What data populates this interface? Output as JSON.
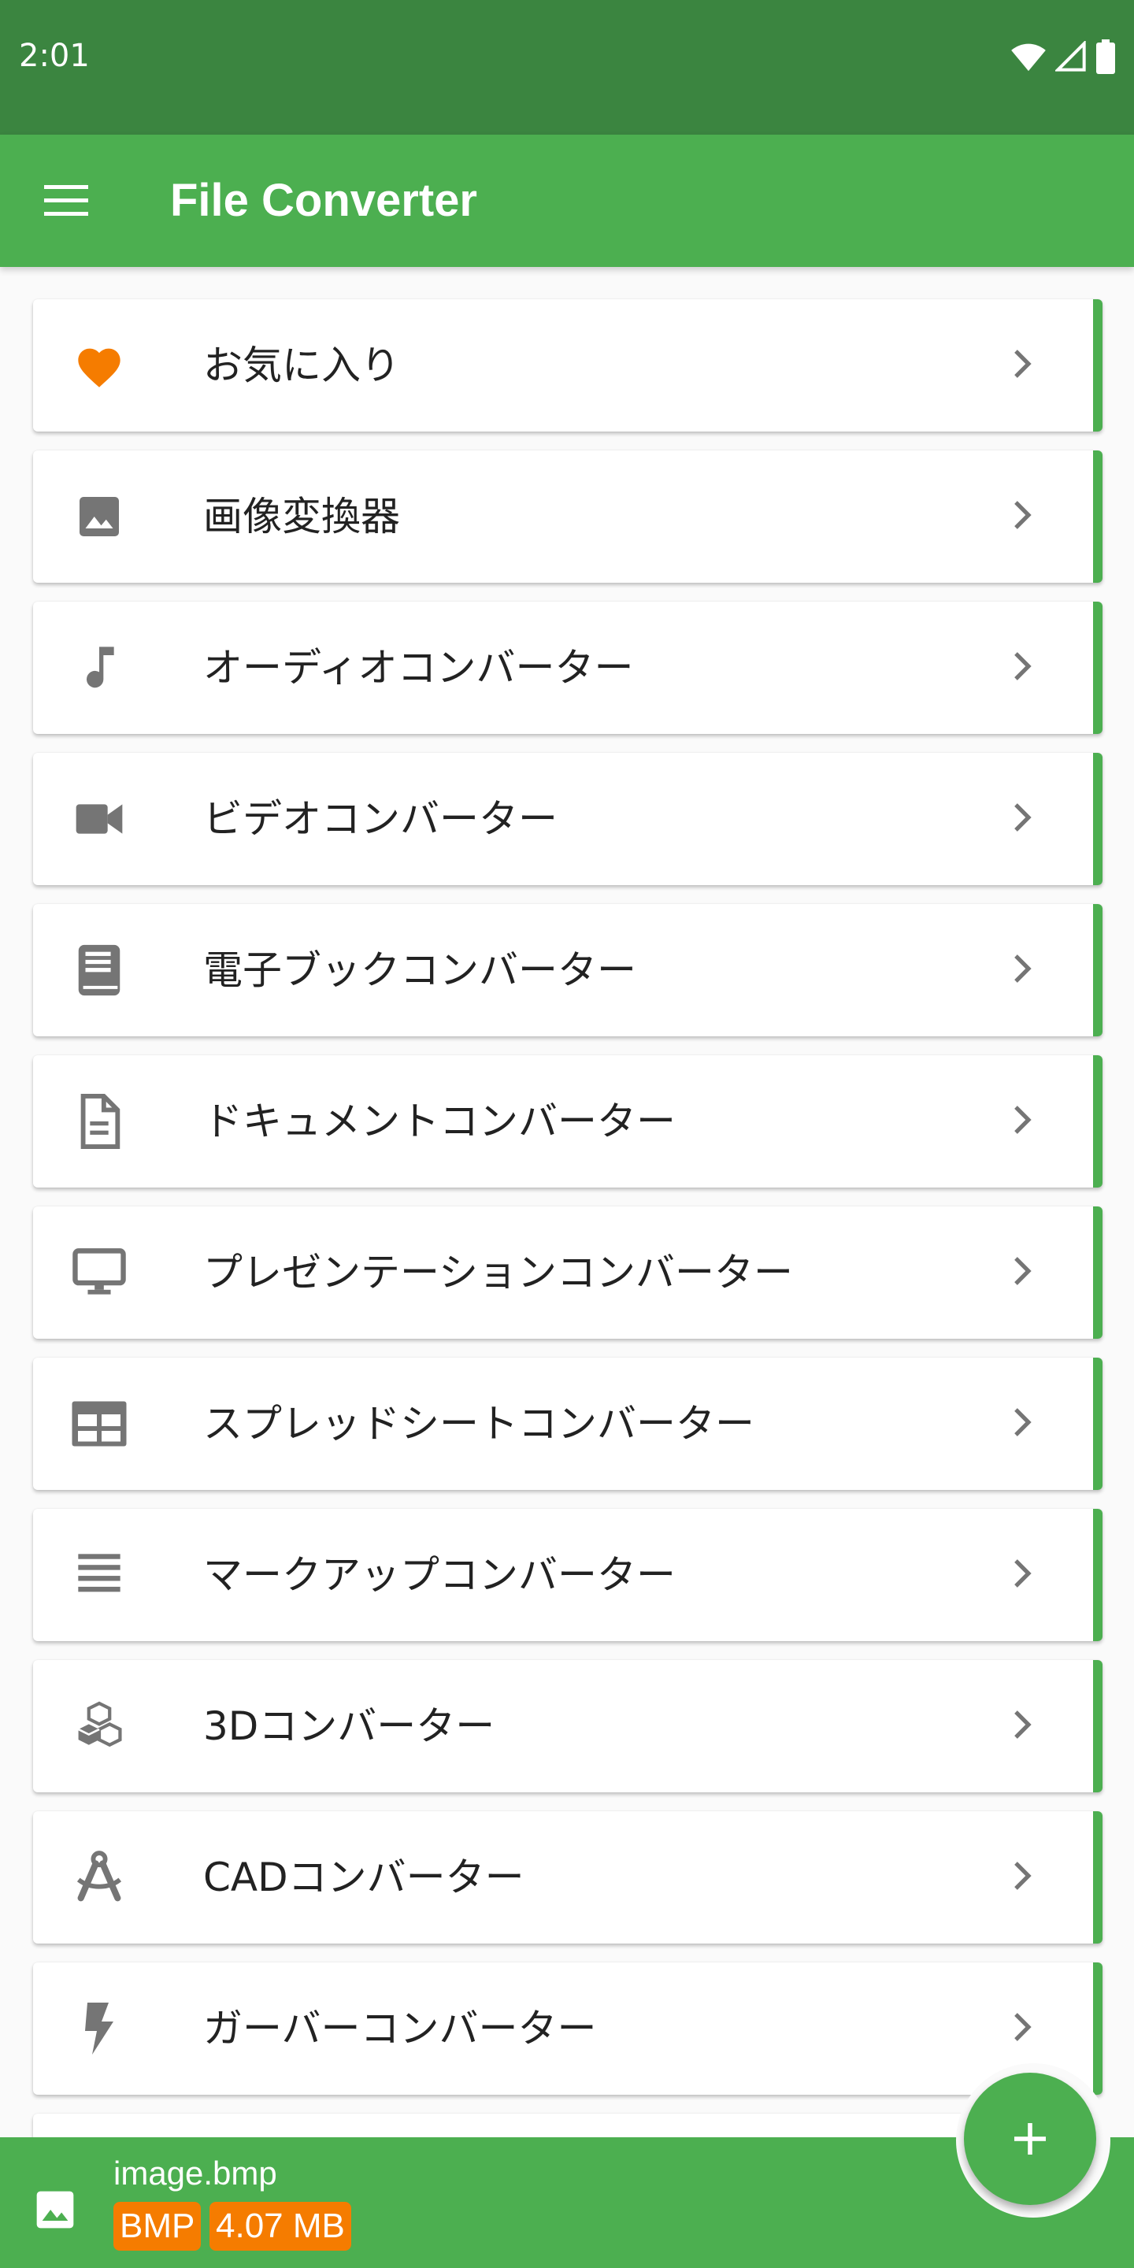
{
  "status_bar": {
    "time": "2:01"
  },
  "app_bar": {
    "title": "File Converter",
    "menu_icon": "hamburger-menu-icon"
  },
  "converters": [
    {
      "label": "お気に入り",
      "icon": "heart-icon"
    },
    {
      "label": "画像変換器",
      "icon": "image-icon"
    },
    {
      "label": "オーディオコンバーター",
      "icon": "music-note-icon"
    },
    {
      "label": "ビデオコンバーター",
      "icon": "videocam-icon"
    },
    {
      "label": "電子ブックコンバーター",
      "icon": "book-icon"
    },
    {
      "label": "ドキュメントコンバーター",
      "icon": "document-icon"
    },
    {
      "label": "プレゼンテーションコンバーター",
      "icon": "monitor-icon"
    },
    {
      "label": "スプレッドシートコンバーター",
      "icon": "table-icon"
    },
    {
      "label": "マークアップコンバーター",
      "icon": "lines-icon"
    },
    {
      "label": "3Dコンバーター",
      "icon": "cubes-icon"
    },
    {
      "label": "CADコンバーター",
      "icon": "compass-icon"
    },
    {
      "label": "ガーバーコンバーター",
      "icon": "bolt-icon"
    }
  ],
  "bottom_bar": {
    "file_name": "image.bmp",
    "format_badge": "BMP",
    "size_badge": "4.07 MB"
  },
  "fab": {
    "icon": "plus-icon"
  },
  "colors": {
    "primary": "#4caf50",
    "primary_dark": "#3b8540",
    "accent": "#f57c00",
    "icon_grey": "#757575"
  }
}
